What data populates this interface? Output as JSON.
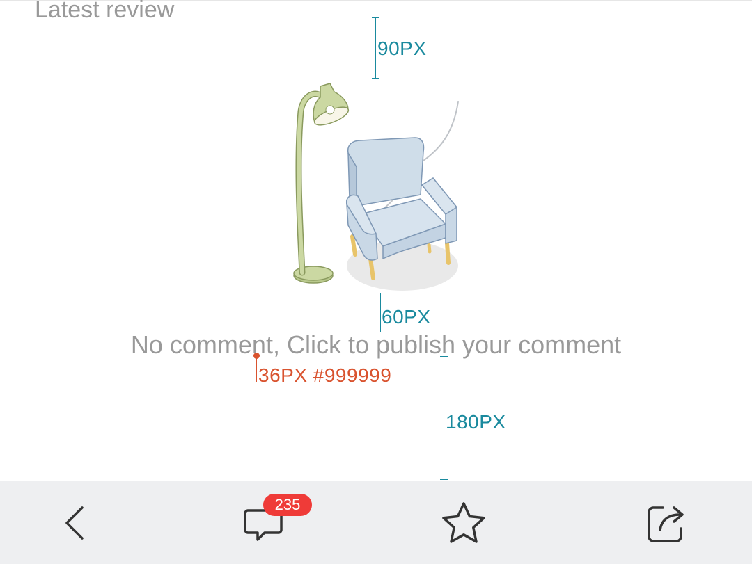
{
  "section": {
    "title": "Latest review"
  },
  "empty_state": {
    "message": "No comment, Click to publish your comment",
    "illustration": "armchair-and-floor-lamp"
  },
  "annotations": {
    "top_gap": "90PX",
    "image_gap": "60PX",
    "text_spec": "36PX #999999",
    "bottom_gap": "180PX"
  },
  "bottom_bar": {
    "back_icon": "chevron-left-icon",
    "comment_icon": "comment-bubble-icon",
    "comment_count": "235",
    "favorite_icon": "star-outline-icon",
    "share_icon": "share-arrow-icon"
  },
  "colors": {
    "text_gray": "#999999",
    "annotation_teal": "#1a8a9e",
    "annotation_red": "#d9532f",
    "badge_red": "#ef3b38",
    "bar_background": "#eeeff1"
  }
}
